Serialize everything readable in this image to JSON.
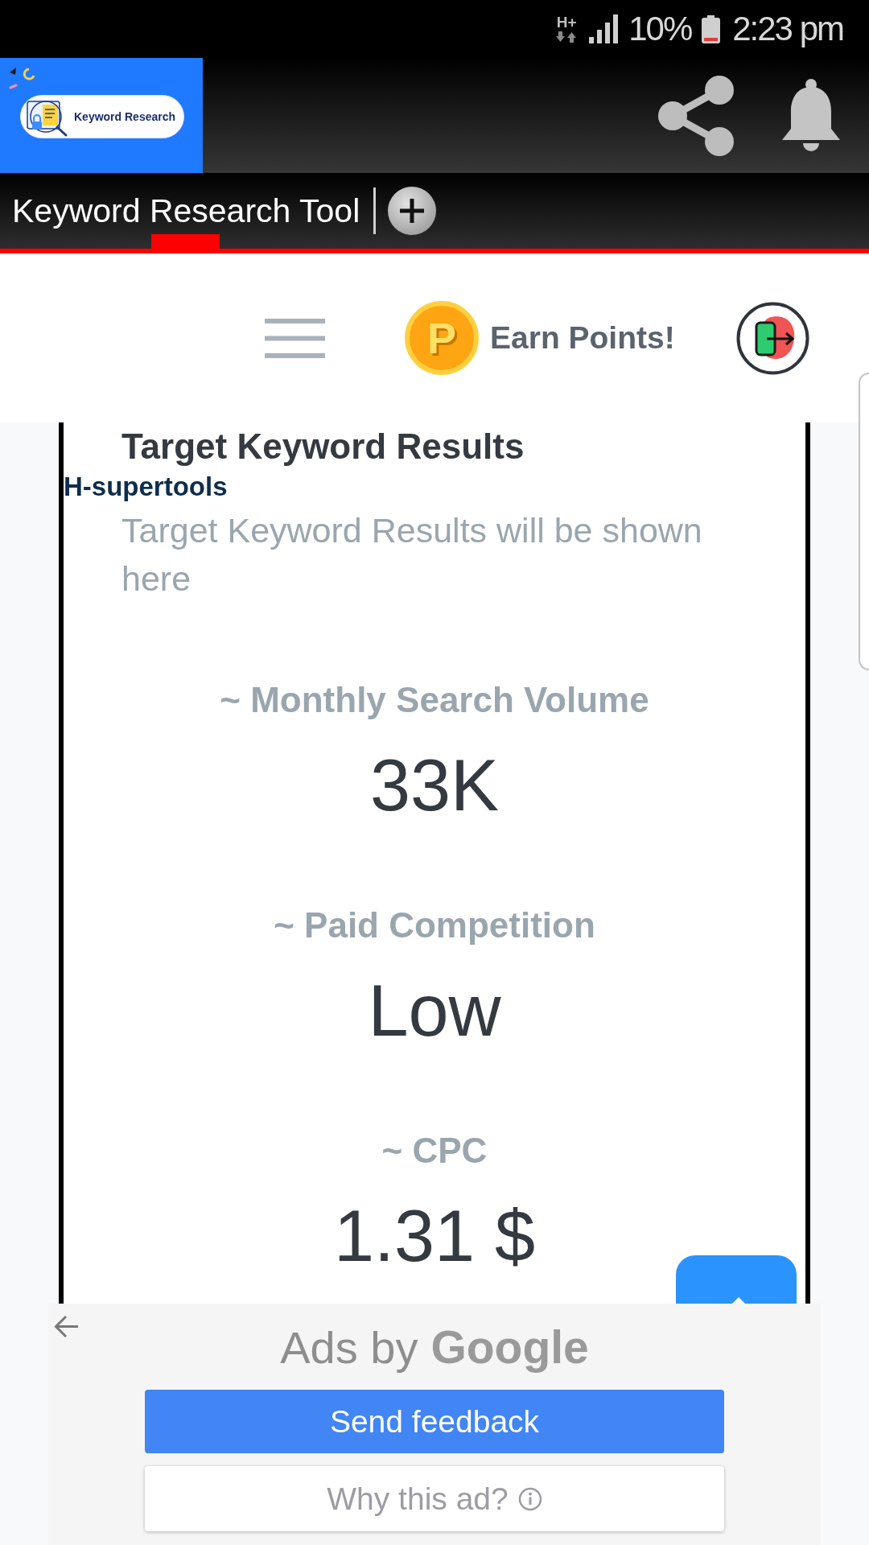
{
  "status_bar": {
    "network_type": "H+",
    "battery": "10%",
    "time": "2:23 pm"
  },
  "app_bar": {
    "logo_text": "Keyword Research"
  },
  "tabs": [
    {
      "label": "Keyword Research Tool",
      "selected": true
    }
  ],
  "nav": {
    "coin_letter": "P",
    "earn_points": "Earn Points!"
  },
  "results": {
    "title": "Target Keyword Results",
    "brand": "H-supertools",
    "message": "Target Keyword Results will be shown here",
    "metrics": [
      {
        "label": "~ Monthly Search Volume",
        "value": "33K"
      },
      {
        "label": "~ Paid Competition",
        "value": "Low"
      },
      {
        "label": "~ CPC",
        "value": "1.31 $"
      }
    ]
  },
  "ad": {
    "label": "Ads by",
    "brand": "Google",
    "buttons": [
      {
        "label": "Send feedback",
        "kind": "primary"
      },
      {
        "label": "Why this ad?",
        "kind": "info"
      }
    ]
  }
}
